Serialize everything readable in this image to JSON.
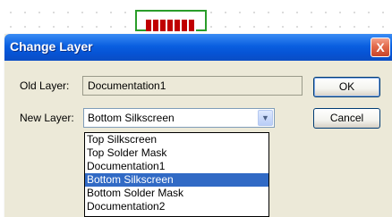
{
  "dialog": {
    "title": "Change Layer",
    "close_glyph": "X",
    "old_layer_label": "Old Layer:",
    "old_layer_value": "Documentation1",
    "new_layer_label": "New Layer:",
    "new_layer_value": "Bottom Silkscreen",
    "ok_label": "OK",
    "cancel_label": "Cancel"
  },
  "dropdown": {
    "options": [
      "Top Silkscreen",
      "Top Solder Mask",
      "Documentation1",
      "Bottom Silkscreen",
      "Bottom Solder Mask",
      "Documentation2"
    ],
    "selected": "Bottom Silkscreen"
  },
  "colors": {
    "titlebar": "#0654d6",
    "selection": "#316ac5",
    "component_outline": "#2a9d2a",
    "component_pins": "#c00000"
  }
}
